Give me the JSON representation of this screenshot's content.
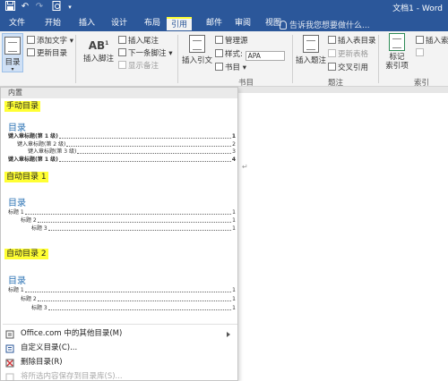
{
  "window": {
    "title": "文档1 - Word"
  },
  "quick_access": {
    "save_icon": "save-icon",
    "undo_icon": "undo-icon",
    "redo_icon": "redo-icon",
    "preview_icon": "print-preview-icon",
    "more_icon": "customize-quick-access-icon"
  },
  "tabs": [
    "文件",
    "开始",
    "插入",
    "设计",
    "布局",
    "引用",
    "邮件",
    "审阅",
    "视图"
  ],
  "active_tab": "引用",
  "tell_me": "告诉我您想要做什么...",
  "ribbon": {
    "toc_button": "目录",
    "add_text": "添加文字",
    "update_toc": "更新目录",
    "insert_footnote": "插入脚注",
    "insert_endnote": "插入尾注",
    "next_footnote": "下一条脚注",
    "show_notes": "显示备注",
    "insert_citation": "插入引文",
    "manage_sources": "管理源",
    "style_label": "样式:",
    "style_value": "APA",
    "bibliography": "书目",
    "bibliography_group": "书目",
    "insert_caption": "插入题注",
    "insert_table_of_figures": "插入表目录",
    "update_table": "更新表格",
    "cross_reference": "交叉引用",
    "captions_group": "题注",
    "mark_entry": "标记\n索引项",
    "insert_index": "插入索引",
    "index_group": "索引",
    "more_label": "插入索引",
    "word_cut": "插入表"
  },
  "menu": {
    "header": "内置",
    "galleries": [
      {
        "name": "手动目录",
        "heading": "目录",
        "lines": [
          {
            "text": "键入章标题(第 1 级)",
            "page": "1",
            "level": 1
          },
          {
            "text": "键入章标题(第 2 级)",
            "page": "2",
            "level": 2
          },
          {
            "text": "键入章标题(第 3 级)",
            "page": "3",
            "level": 3
          },
          {
            "text": "键入章标题(第 1 级)",
            "page": "4",
            "level": 1
          }
        ]
      },
      {
        "name": "自动目录 1",
        "heading": "目录",
        "lines": [
          {
            "text": "标题 1",
            "page": "1",
            "level": 1
          },
          {
            "text": "标题 2",
            "page": "1",
            "level": 2
          },
          {
            "text": "标题 3",
            "page": "1",
            "level": 3
          }
        ]
      },
      {
        "name": "自动目录 2",
        "heading": "目录",
        "lines": [
          {
            "text": "标题 1",
            "page": "1",
            "level": 1
          },
          {
            "text": "标题 2",
            "page": "1",
            "level": 2
          },
          {
            "text": "标题 3",
            "page": "1",
            "level": 3
          }
        ]
      }
    ],
    "items": [
      {
        "label": "Office.com 中的其他目录(M)",
        "icon": "office-icon",
        "submenu": true,
        "disabled": false
      },
      {
        "label": "自定义目录(C)...",
        "icon": "custom-toc-icon",
        "submenu": false,
        "disabled": false
      },
      {
        "label": "删除目录(R)",
        "icon": "remove-toc-icon",
        "submenu": false,
        "disabled": false
      },
      {
        "label": "将所选内容保存到目录库(S)...",
        "icon": "save-selection-icon",
        "submenu": false,
        "disabled": true
      }
    ]
  },
  "document": {
    "paragraph_mark": "↵"
  },
  "colors": {
    "title_bar": "#2b579a",
    "highlight": "#ffff33",
    "toc_heading": "#2e74b5"
  }
}
